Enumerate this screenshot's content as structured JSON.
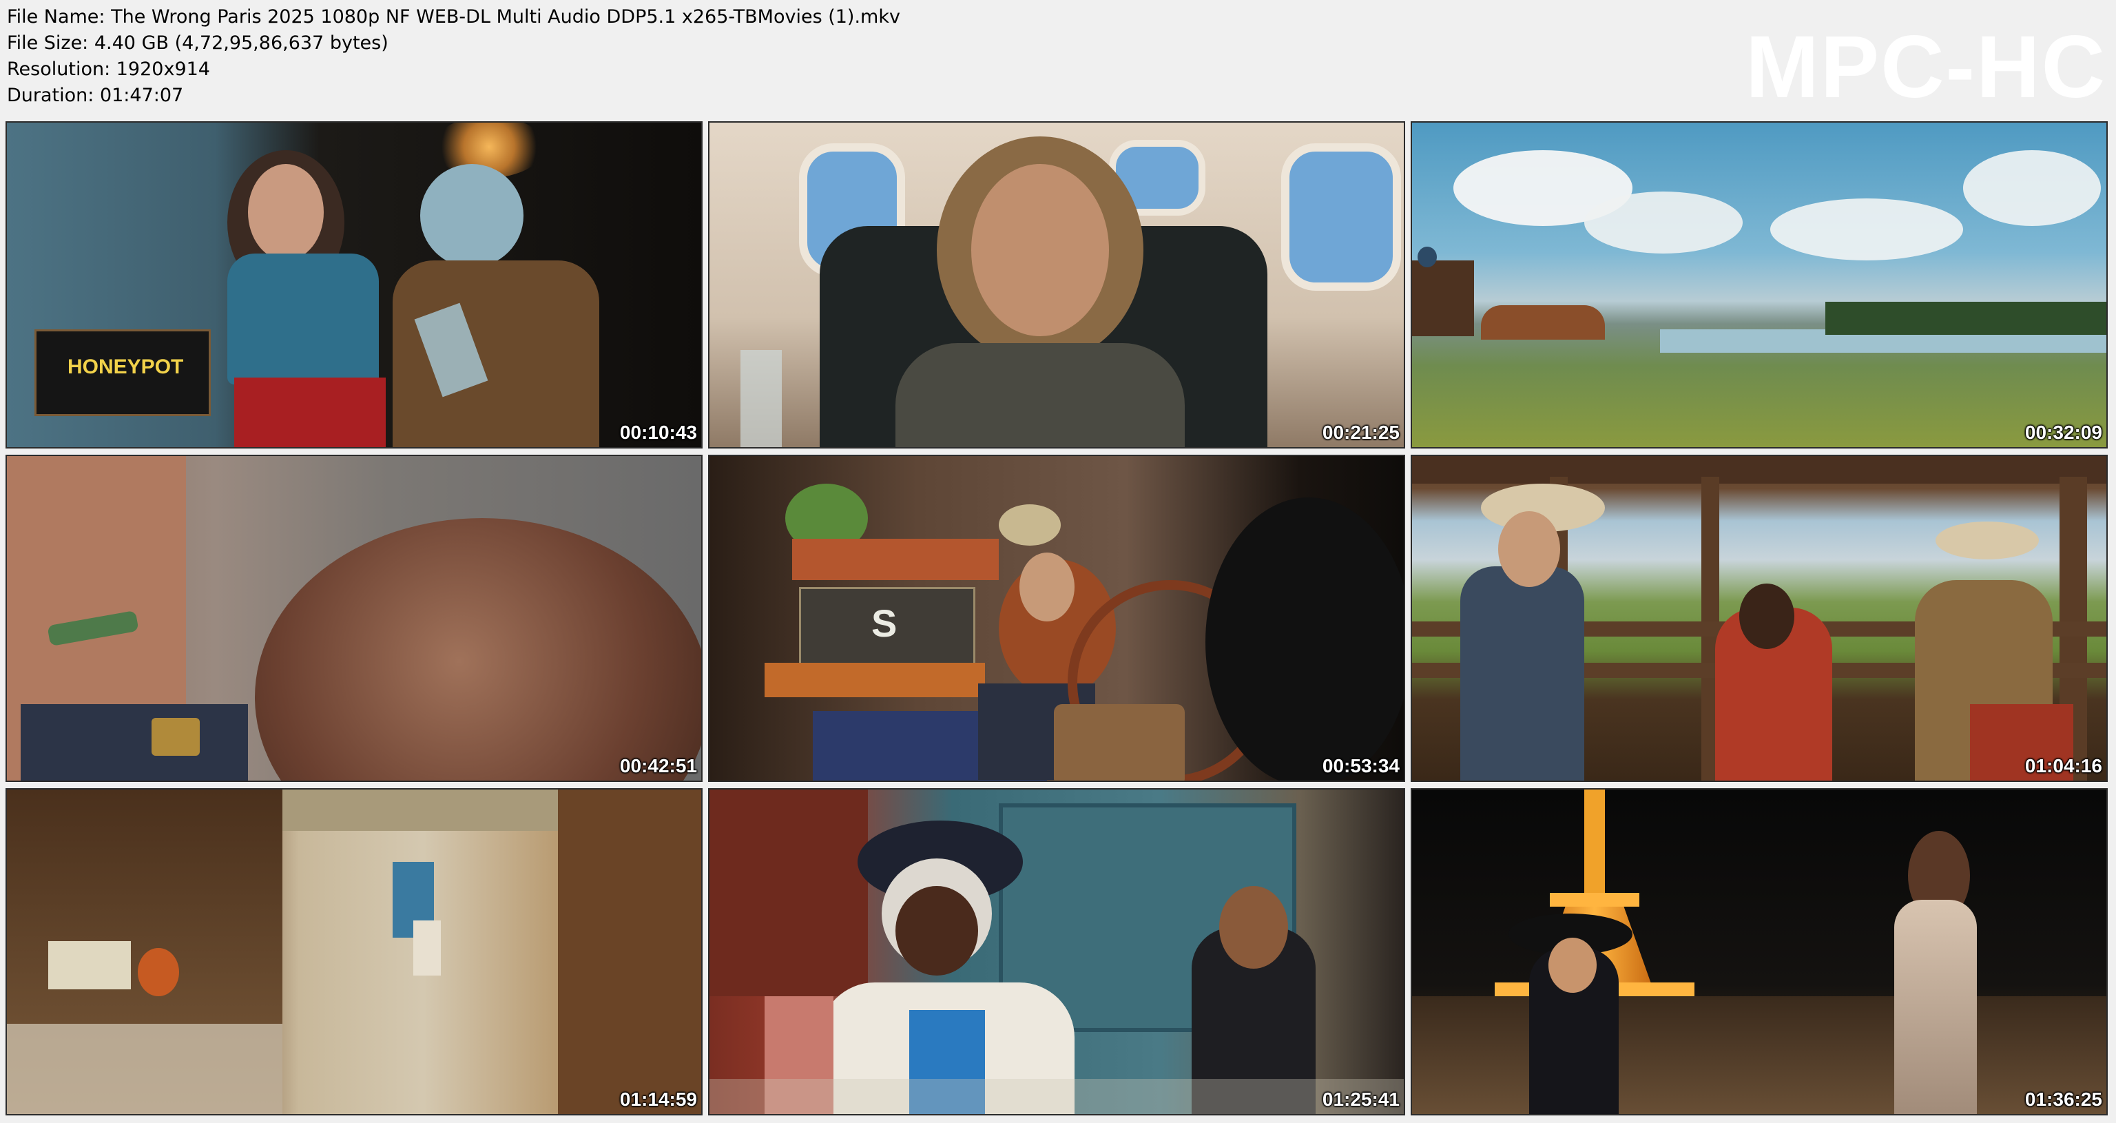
{
  "file_info": {
    "file_name": "File Name: The Wrong Paris 2025 1080p NF WEB-DL Multi Audio DDP5.1 x265-TBMovies (1).mkv",
    "file_size": "File Size: 4.40 GB (4,72,95,86,637 bytes)",
    "resolution": "Resolution: 1920x914",
    "duration": "Duration: 01:47:07"
  },
  "logo": "MPC-HC",
  "thumbnails": [
    {
      "timestamp": "00:10:43",
      "sign": "HONEYPOT"
    },
    {
      "timestamp": "00:21:25"
    },
    {
      "timestamp": "00:32:09"
    },
    {
      "timestamp": "00:42:51"
    },
    {
      "timestamp": "00:53:34",
      "sign": "S"
    },
    {
      "timestamp": "01:04:16"
    },
    {
      "timestamp": "01:14:59"
    },
    {
      "timestamp": "01:25:41"
    },
    {
      "timestamp": "01:36:25"
    }
  ],
  "colors": {
    "background": "#f0f0f0",
    "thumb_border": "#2b2b2b",
    "timestamp_text": "#ffffff",
    "logo_text": "#ffffff"
  }
}
